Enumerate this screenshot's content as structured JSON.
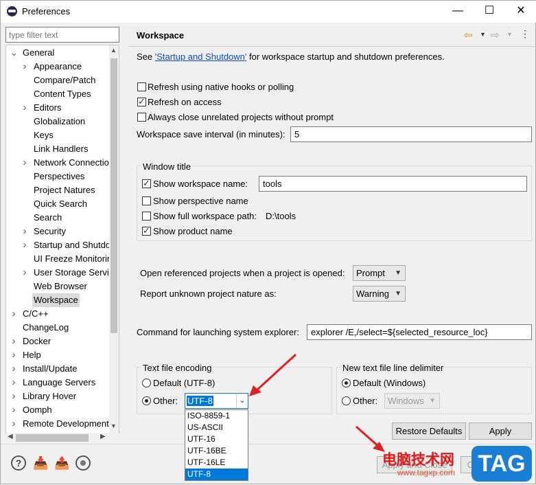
{
  "window": {
    "title": "Preferences",
    "minimize": "—",
    "maximize": "☐",
    "close": "✕"
  },
  "filter": {
    "placeholder": "type filter text"
  },
  "tree": {
    "items": [
      {
        "label": "General",
        "expanded": true
      },
      {
        "label": "Appearance"
      },
      {
        "label": "Compare/Patch"
      },
      {
        "label": "Content Types"
      },
      {
        "label": "Editors"
      },
      {
        "label": "Globalization"
      },
      {
        "label": "Keys"
      },
      {
        "label": "Link Handlers"
      },
      {
        "label": "Network Connectio"
      },
      {
        "label": "Perspectives"
      },
      {
        "label": "Project Natures"
      },
      {
        "label": "Quick Search"
      },
      {
        "label": "Search"
      },
      {
        "label": "Security"
      },
      {
        "label": "Startup and Shutdo"
      },
      {
        "label": "UI Freeze Monitorir"
      },
      {
        "label": "User Storage Servic"
      },
      {
        "label": "Web Browser"
      },
      {
        "label": "Workspace",
        "selected": true
      },
      {
        "label": "C/C++"
      },
      {
        "label": "ChangeLog"
      },
      {
        "label": "Docker"
      },
      {
        "label": "Help"
      },
      {
        "label": "Install/Update"
      },
      {
        "label": "Language Servers"
      },
      {
        "label": "Library Hover"
      },
      {
        "label": "Oomph"
      },
      {
        "label": "Remote Development"
      }
    ]
  },
  "page": {
    "title": "Workspace",
    "intro_prefix": "See",
    "intro_link": "'Startup and Shutdown'",
    "intro_suffix": "for workspace startup and shutdown preferences.",
    "refresh_native": "Refresh using native hooks or polling",
    "refresh_access": "Refresh on access",
    "always_close": "Always close unrelated projects without prompt",
    "save_interval_label": "Workspace save interval (in minutes):",
    "save_interval_value": "5",
    "window_title_group": "Window title",
    "show_ws_name": "Show workspace name:",
    "ws_name_value": "tools",
    "show_perspective": "Show perspective name",
    "show_full_path": "Show full workspace path:",
    "full_path_value": "D:\\tools",
    "show_product": "Show product name",
    "open_ref_label": "Open referenced projects when a project is opened:",
    "open_ref_value": "Prompt",
    "report_nature_label": "Report unknown project nature as:",
    "report_nature_value": "Warning",
    "cmd_label": "Command for launching system explorer:",
    "cmd_value": "explorer /E,/select=${selected_resource_loc}",
    "encoding_group": "Text file encoding",
    "enc_default": "Default (UTF-8)",
    "enc_other": "Other:",
    "enc_value": "UTF-8",
    "delim_group": "New text file line delimiter",
    "delim_default": "Default (Windows)",
    "delim_other": "Other:",
    "delim_value": "Windows",
    "restore_defaults": "Restore Defaults",
    "apply": "Apply",
    "apply_close": "Apply and Close",
    "cancel": "Cancel"
  },
  "encoding_options": [
    "ISO-8859-1",
    "US-ASCII",
    "UTF-16",
    "UTF-16BE",
    "UTF-16LE",
    "UTF-8"
  ],
  "watermark": {
    "text": "电脑技术网",
    "url": "www.tagxp.com",
    "badge": "TAG"
  },
  "colors": {
    "selection": "#0078d7",
    "link": "#0c4bc4",
    "arrow": "#e02020"
  }
}
